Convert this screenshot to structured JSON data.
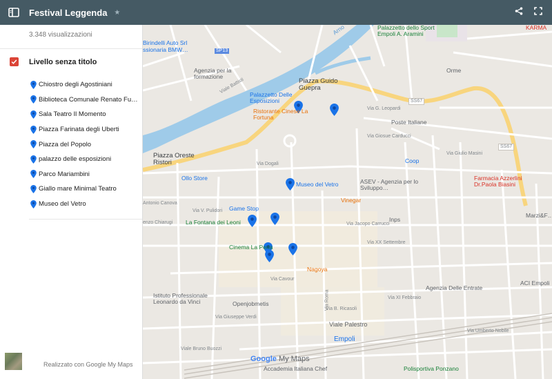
{
  "header": {
    "title": "Festival Leggenda"
  },
  "panel": {
    "views": "3.348 visualizzazioni",
    "layer_title": "Livello senza titolo",
    "items": [
      "Chiostro degli Agostiniani",
      "Biblioteca Comunale Renato Fu…",
      "Sala Teatro Il Momento",
      "Piazza Farinata degli Uberti",
      "Piazza del Popolo",
      "palazzo delle esposizioni",
      "Parco Mariambini",
      "Giallo mare Minimal Teatro",
      "Museo del Vetro"
    ],
    "footer": "Realizzato con Google My Maps"
  },
  "map": {
    "labels": {
      "birindelli": "Birindelli Auto Srl",
      "concessionaria": "ssionaria BMW…",
      "sp13": "SP13",
      "agenzia_form": "Agenzia per la formazione",
      "piazza_guido": "Piazza Guido Guepra",
      "palazzetto_esp": "Palazzetto Delle Esposizioni",
      "ristorante": "Ristorante Cinese La Fortuna",
      "poste": "Poste Italiane",
      "piazza_oreste": "Piazza Oreste Ristori",
      "coop": "Coop",
      "ollo": "Ollo Store",
      "museo_vetro": "Museo del Vetro",
      "asev": "ASEV - Agenzia per lo Sviluppo…",
      "vinegar": "Vinegar",
      "game_stop": "Game Stop",
      "fontana": "La Fontana dei Leoni",
      "inps": "Inps",
      "cinema": "Cinema La Perla",
      "nagoya": "Nagoya",
      "istituto": "Istituto Professionale Leonardo da Vinci",
      "openjob": "Openjobmetis",
      "agenzia_entrate": "Agenzia Delle Entrate",
      "aci": "ACI Empoli",
      "empoli_st": "Empoli",
      "accademia": "Accademia Italiana Chef",
      "polisportiva": "Polisportiva Ponzano",
      "palazzetto_sport": "Palazzetto dello Sport Empoli A. Aramini",
      "karma": "KARMA",
      "farmacia": "Farmacia Azzerlini Dr.Paola Biasini",
      "marzi": "Marzi&F…",
      "orme": "Orme",
      "arno": "Arno",
      "ss67a": "SS67",
      "ss67b": "SS67",
      "via_dogali": "Via Dogali",
      "via_cavour": "Via Cavour",
      "viale_palestro": "Viale Palestro",
      "via_xi_feb": "Via XI Febbraio",
      "via_roma": "Via Roma",
      "via_carrucci": "Via Jacopo Carrucci",
      "via_xx_sett": "Via XX Settembre",
      "via_leopardi": "Via G. Leopardi",
      "via_carducci": "Via Giosue Carducci",
      "via_mazzini": "Via Giulio Masini",
      "via_verdi": "Via Giuseppe Verdi",
      "via_ricasoli": "Via B. Ricasoli",
      "viale_buozzi": "Viale Bruno Buozzi",
      "via_nobile": "Via Umberto Nobile",
      "via_chiarugi": "enzo Chiarugi",
      "via_canova": "Antonio Canova",
      "via_pulidori": "Via V. Pulidori",
      "viale_battisti": "Viale Battisti"
    },
    "google_logo": "Google",
    "my_maps": "My Maps"
  },
  "colors": {
    "header": "#455a64",
    "checkbox": "#db4437",
    "pin": "#1a73e8",
    "road_major": "#f8d57e"
  }
}
